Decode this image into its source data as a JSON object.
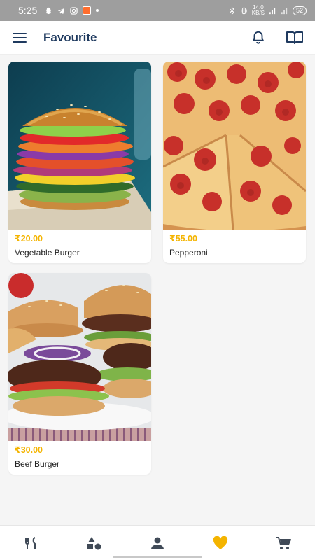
{
  "status_bar": {
    "time": "5:25",
    "speed_value": "14.0",
    "speed_unit": "KB/S",
    "battery": "52"
  },
  "header": {
    "title": "Favourite"
  },
  "favourites": [
    {
      "price": "₹20.00",
      "name": "Vegetable Burger"
    },
    {
      "price": "₹55.00",
      "name": "Pepperoni"
    },
    {
      "price": "₹30.00",
      "name": "Beef Burger"
    }
  ],
  "bottom_nav": {
    "items": [
      "fork-knife-icon",
      "categories-icon",
      "profile-icon",
      "heart-icon",
      "cart-icon"
    ],
    "active_index": 3
  },
  "colors": {
    "title": "#1f3a5f",
    "price": "#f4b400",
    "active_nav": "#f4b400",
    "inactive_nav": "#404a57"
  }
}
